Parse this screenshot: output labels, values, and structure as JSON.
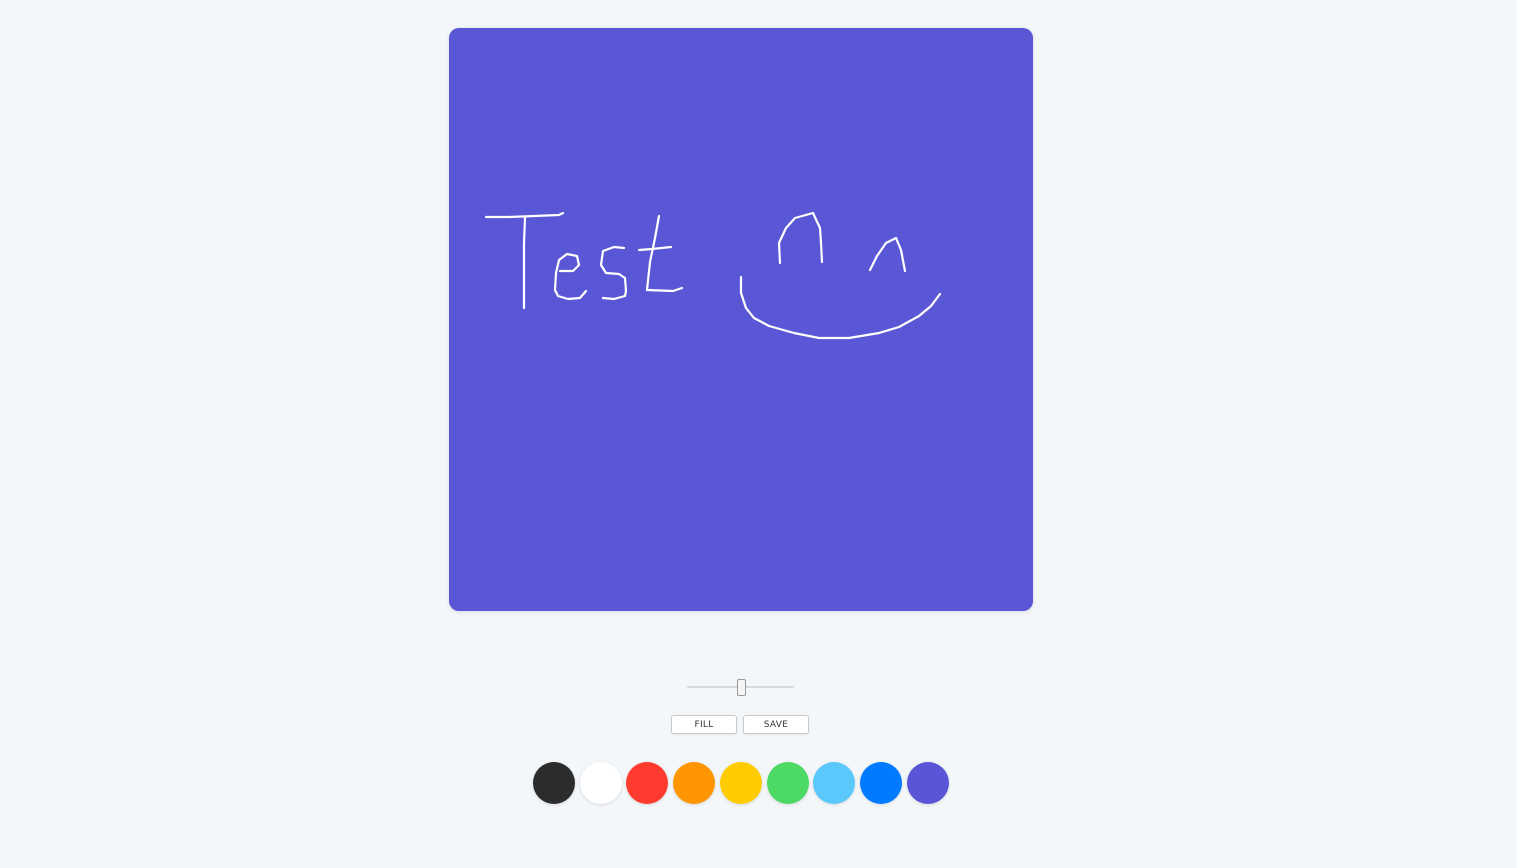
{
  "canvas": {
    "background": "#5a57d6",
    "stroke_color": "#ffffff",
    "drawn_text": "Test"
  },
  "brush_size": {
    "fraction": 0.5
  },
  "buttons": {
    "fill_label": "FILL",
    "save_label": "SAVE"
  },
  "palette": [
    {
      "name": "black",
      "color": "#2c2c2c"
    },
    {
      "name": "white",
      "color": "#ffffff"
    },
    {
      "name": "red",
      "color": "#ff3b30"
    },
    {
      "name": "orange",
      "color": "#ff9500"
    },
    {
      "name": "yellow",
      "color": "#ffcc00"
    },
    {
      "name": "green",
      "color": "#4cd964"
    },
    {
      "name": "light-blue",
      "color": "#5ac8fa"
    },
    {
      "name": "blue",
      "color": "#007aff"
    },
    {
      "name": "indigo",
      "color": "#5856d6"
    }
  ]
}
